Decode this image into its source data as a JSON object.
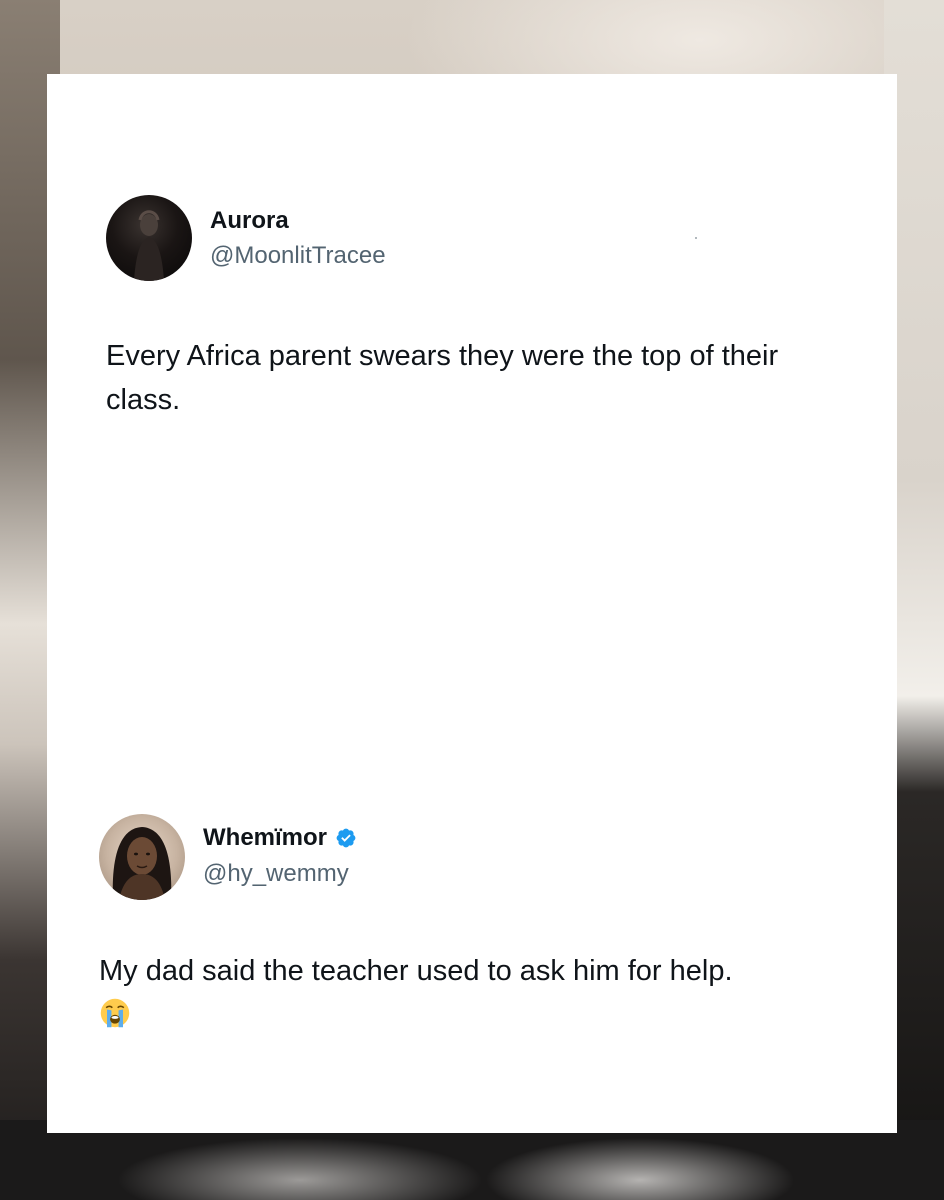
{
  "tweets": [
    {
      "display_name": "Aurora",
      "handle": "@MoonlitTracee",
      "verified": false,
      "text": "Every Africa parent swears they were the top of their class."
    },
    {
      "display_name": "Whemïmor",
      "handle": "@hy_wemmy",
      "verified": true,
      "text": "My dad said the teacher used to ask him for help.",
      "emoji": "loudly-crying-face"
    }
  ],
  "colors": {
    "name": "#0f1419",
    "handle": "#536471",
    "verified": "#1d9bf0",
    "card": "#ffffff"
  },
  "icons": [
    "verified-badge-icon",
    "loudly-crying-face-icon"
  ]
}
